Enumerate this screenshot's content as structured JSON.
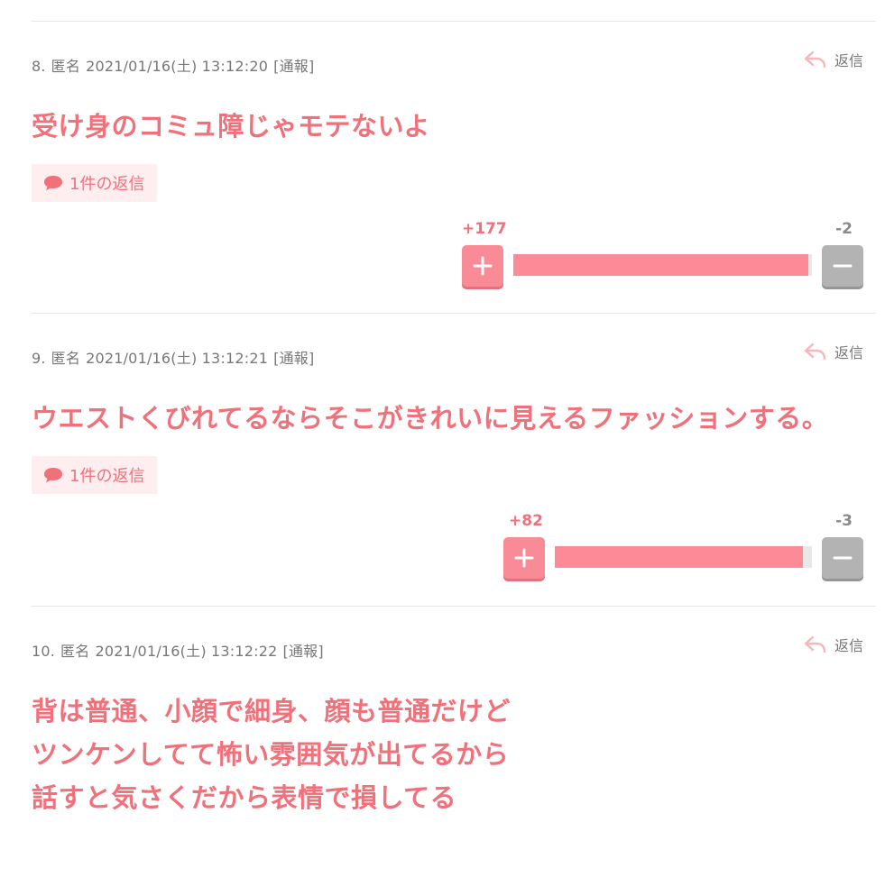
{
  "comments": [
    {
      "meta": {
        "number": "8.",
        "author": "匿名",
        "datetime": "2021/01/16(土) 13:12:20",
        "report": "[通報]"
      },
      "reply_label": "返信",
      "body_lines": [
        "受け身のコミュ障じゃモテないよ"
      ],
      "reply_count_label": "1件の返信",
      "votes": {
        "plus": "+177",
        "minus": "-2",
        "plus_ratio": 0.989
      }
    },
    {
      "meta": {
        "number": "9.",
        "author": "匿名",
        "datetime": "2021/01/16(土) 13:12:21",
        "report": "[通報]"
      },
      "reply_label": "返信",
      "body_lines": [
        "ウエストくびれてるならそこがきれいに見えるファッションする。"
      ],
      "reply_count_label": "1件の返信",
      "votes": {
        "plus": "+82",
        "minus": "-3",
        "plus_ratio": 0.965
      }
    },
    {
      "meta": {
        "number": "10.",
        "author": "匿名",
        "datetime": "2021/01/16(土) 13:12:22",
        "report": "[通報]"
      },
      "reply_label": "返信",
      "body_lines": [
        "背は普通、小顔で細身、顔も普通だけど",
        "ツンケンしてて怖い雰囲気が出てるから",
        "話すと気さくだから表情で損してる"
      ]
    }
  ],
  "colors": {
    "accent": "#f0717a",
    "plus_button": "#f98b97",
    "minus_button": "#b3b3b3",
    "bar_fill": "#fd8b97"
  },
  "icons": {
    "reply": "reply-arrow-icon",
    "speech": "speech-bubble-icon",
    "plus": "plus-icon",
    "minus": "minus-icon"
  }
}
